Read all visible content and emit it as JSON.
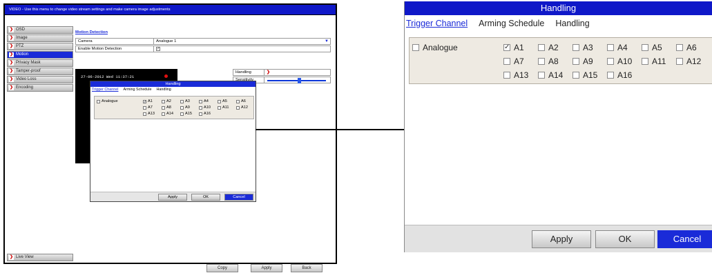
{
  "dvr": {
    "topbar": "VIDEO - Use this menu to change video stream settings and make camera image adjustments",
    "sidebar": [
      {
        "label": "OSD"
      },
      {
        "label": "Image"
      },
      {
        "label": "PTZ"
      },
      {
        "label": "Motion",
        "active": true
      },
      {
        "label": "Privacy Mask"
      },
      {
        "label": "Tamper-proof"
      },
      {
        "label": "Video Loss"
      },
      {
        "label": "Encoding"
      }
    ],
    "live_view": "Live View",
    "section_title": "Motion Detection",
    "camera_label": "Camera",
    "camera_value": "Analogue 1",
    "enable_label": "Enable Motion Detection",
    "timestamp": "27-06-2012 Wed 11:37:21",
    "handling_label": "Handling",
    "sensitivity_label": "Sensitivity",
    "sensitivity_level": 0.52,
    "buttons": {
      "copy": "Copy",
      "apply": "Apply",
      "back": "Back"
    }
  },
  "dialog": {
    "title": "Handling",
    "tabs": [
      "Trigger Channel",
      "Arming Schedule",
      "Handling"
    ],
    "active_tab": "Trigger Channel",
    "group_label": "Analogue",
    "channels": [
      {
        "label": "A1",
        "checked": true
      },
      {
        "label": "A2",
        "checked": false
      },
      {
        "label": "A3",
        "checked": false
      },
      {
        "label": "A4",
        "checked": false
      },
      {
        "label": "A5",
        "checked": false
      },
      {
        "label": "A6",
        "checked": false
      },
      {
        "label": "A7",
        "checked": false
      },
      {
        "label": "A8",
        "checked": false
      },
      {
        "label": "A9",
        "checked": false
      },
      {
        "label": "A10",
        "checked": false
      },
      {
        "label": "A11",
        "checked": false
      },
      {
        "label": "A12",
        "checked": false
      },
      {
        "label": "A13",
        "checked": false
      },
      {
        "label": "A14",
        "checked": false
      },
      {
        "label": "A15",
        "checked": false
      },
      {
        "label": "A16",
        "checked": false
      }
    ],
    "buttons": {
      "apply": "Apply",
      "ok": "OK",
      "cancel": "Cancel"
    }
  },
  "colors": {
    "title_blue": "#0f18c8",
    "accent_blue": "#1a2bd8",
    "group_bg": "#eeeae2",
    "record_dot": "#e01010"
  }
}
